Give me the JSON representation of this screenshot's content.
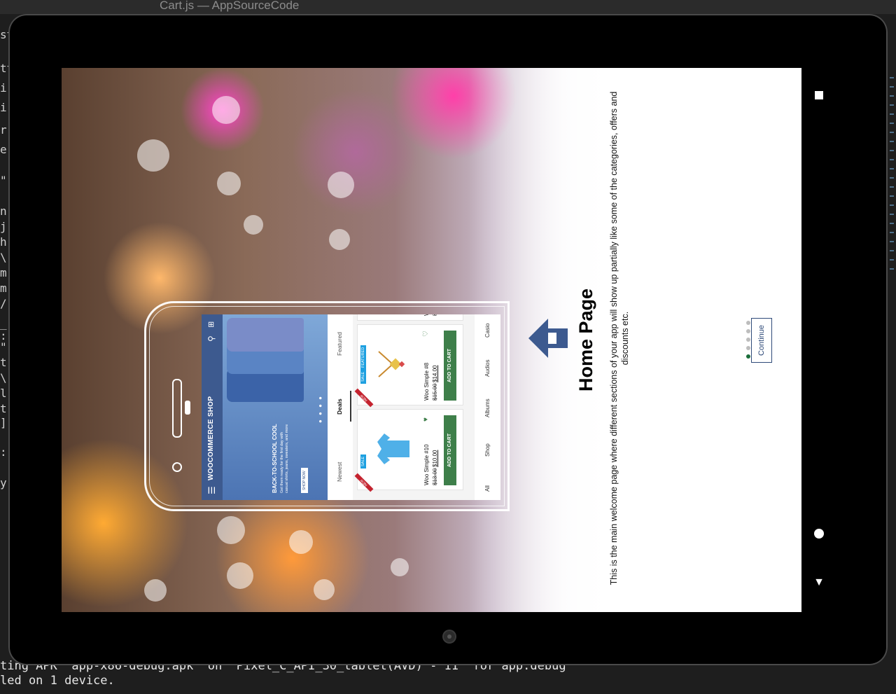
{
  "editor": {
    "window_title": "Cart.js — AppSourceCode",
    "left_code_fragments": [
      "st",
      "tt",
      "i",
      "i",
      "r",
      "e",
      "\"",
      "n",
      "j",
      "h",
      "\\",
      "m",
      "m",
      "/",
      "_",
      ":",
      "\"",
      "t",
      "\\",
      "l",
      "t",
      "]",
      ":",
      "y"
    ],
    "console_lines": [
      "ting APK 'app-x86-debug.apk' on 'Pixel_C_API_30_tablet(AVD) - 11' for app:debug",
      "led on 1 device."
    ]
  },
  "navigation": {
    "recents_icon": "square-icon",
    "home_icon": "circle-icon",
    "back_icon": "triangle-icon",
    "back_glyph": "▼"
  },
  "onboarding": {
    "title": "Home Page",
    "description": "This is the main welcome page where different sections of your app will show up partially like some of the categories, offers and discounts etc.",
    "continue_label": "Continue",
    "page_count": 5,
    "active_page": 1,
    "arrow_icon": "home-arrow-icon",
    "accent_color": "#3d5a8f"
  },
  "phone_mockup": {
    "app_title": "WOOCOMMERCE SHOP",
    "banner": {
      "heading": "BACK-TO-SCHOOL COOL",
      "text": "Get them ready for the first day with casual shirts, jeans, sweaters, and more",
      "button": "SHOP NOW"
    },
    "tabs": [
      "Newest",
      "Deals",
      "Featured"
    ],
    "active_tab": "Deals",
    "products": [
      {
        "name": "Woo Simple #10",
        "old_price": "$13.00",
        "new_price": "$10.00",
        "cta": "ADD TO CART",
        "badges": [
          "NEW",
          "SALE"
        ]
      },
      {
        "name": "Woo Simple #8",
        "old_price": "$15.00",
        "new_price": "$14.00",
        "cta": "ADD TO CART",
        "badges": [
          "NEW",
          "SALE",
          "FEATURED"
        ]
      }
    ],
    "partial_product": {
      "name": "Wo",
      "price": "$1"
    },
    "categories": [
      "All",
      "Shop",
      "Albums",
      "Audios",
      "Casio"
    ]
  }
}
